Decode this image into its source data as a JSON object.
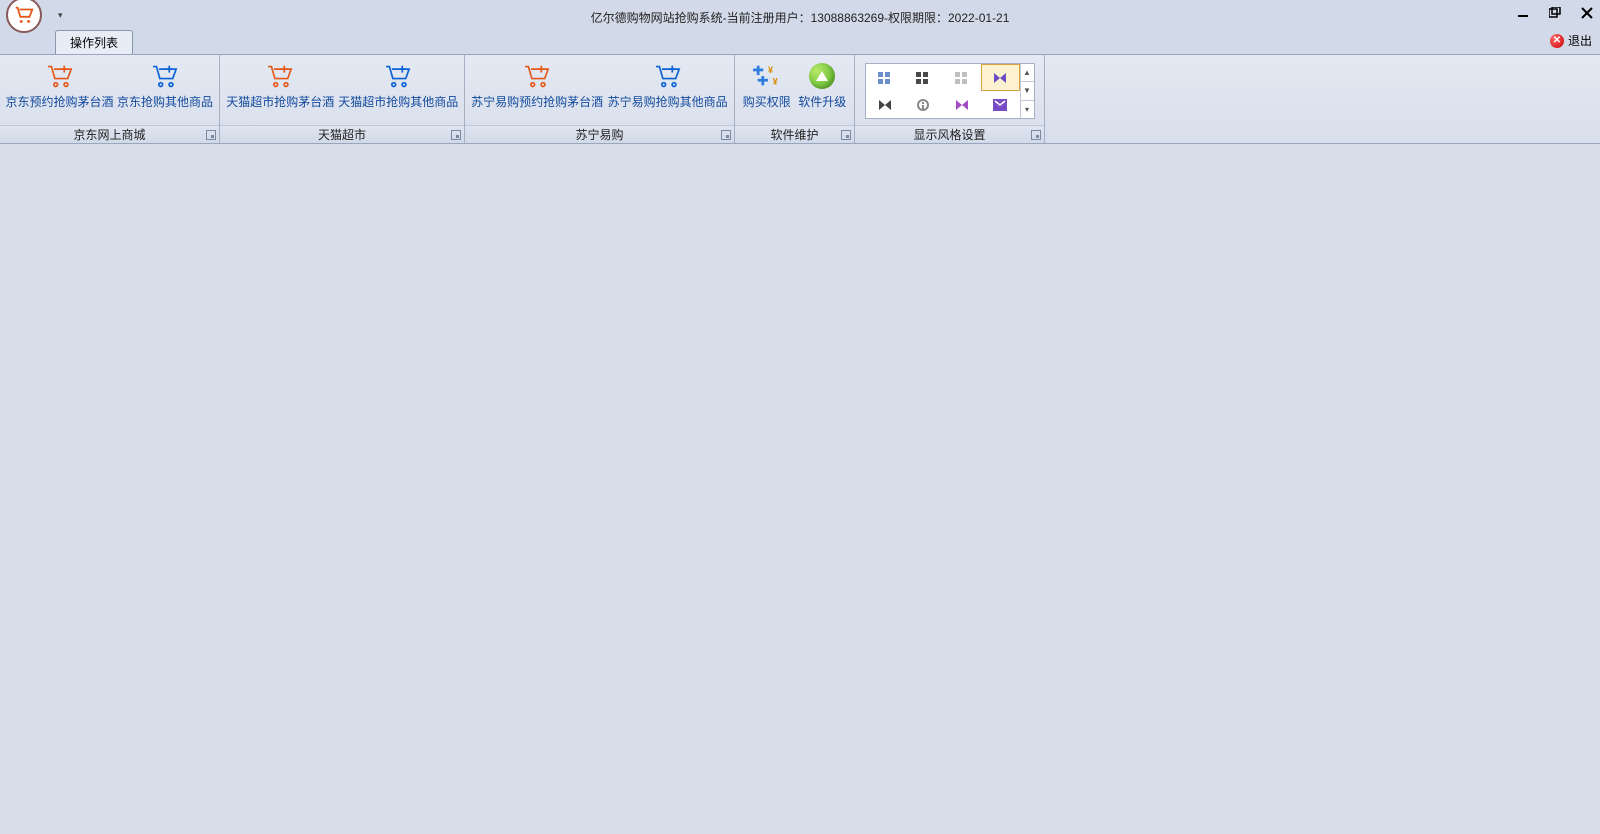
{
  "window": {
    "title": "亿尔德购物网站抢购系统-当前注册用户：13088863269-权限期限：2022-01-21"
  },
  "tab": {
    "label": "操作列表"
  },
  "exit": {
    "label": "退出"
  },
  "groups": {
    "jd": {
      "label": "京东网上商城",
      "btn1": "京东预约抢购茅台酒",
      "btn2": "京东抢购其他商品"
    },
    "tmall": {
      "label": "天猫超市",
      "btn1": "天猫超市抢购茅台酒",
      "btn2": "天猫超市抢购其他商品"
    },
    "suning": {
      "label": "苏宁易购",
      "btn1": "苏宁易购预约抢购茅台酒",
      "btn2": "苏宁易购抢购其他商品"
    },
    "maint": {
      "label": "软件维护",
      "btn1": "购买权限",
      "btn2": "软件升级"
    },
    "style": {
      "label": "显示风格设置"
    }
  }
}
